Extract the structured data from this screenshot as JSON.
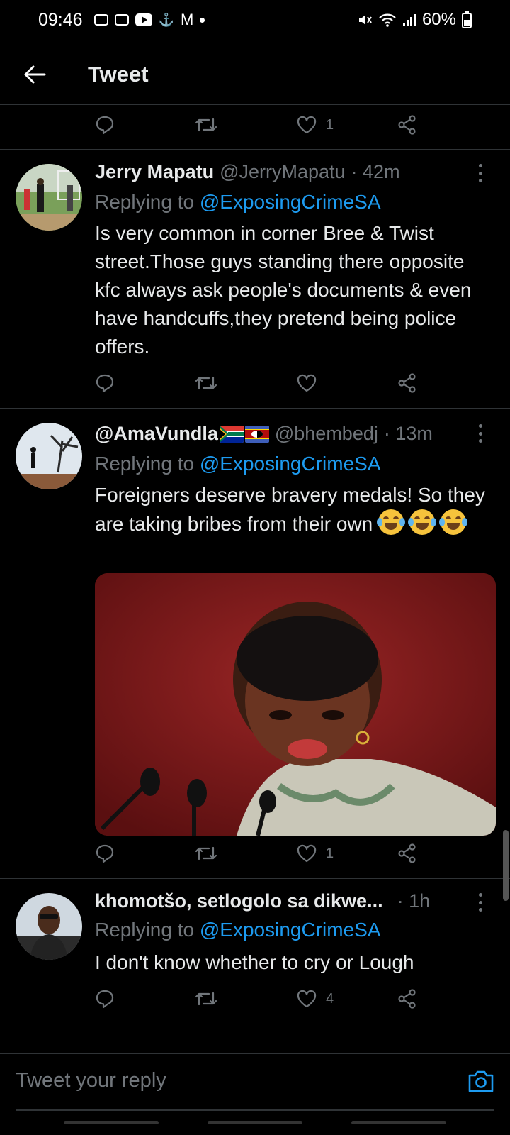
{
  "status_bar": {
    "time": "09:46",
    "battery": "60%",
    "icons": [
      "youtube-studio-icon",
      "youtube-studio-icon",
      "youtube-icon",
      "notification-icon",
      "gmail-icon",
      "dot-icon",
      "mute-icon",
      "wifi-icon",
      "signal-icon",
      "battery-icon"
    ]
  },
  "header": {
    "title": "Tweet"
  },
  "top_actions": {
    "like_count": "1"
  },
  "tweets": [
    {
      "name": "Jerry Mapatu",
      "handle": "@JerryMapatu",
      "time": "· 42m",
      "replying_prefix": "Replying to ",
      "replying_to": "@ExposingCrimeSA",
      "text": "Is very common in corner Bree & Twist street.Those guys standing there opposite kfc always ask people's documents & even have handcuffs,they pretend being police offers.",
      "like_count": ""
    },
    {
      "name": "@AmaVundla",
      "handle": "@bhembedj",
      "time": "· 13m",
      "replying_prefix": "Replying to ",
      "replying_to": "@ExposingCrimeSA",
      "text": "Foreigners deserve bravery medals! So they are taking bribes from their own",
      "like_count": "1"
    },
    {
      "name": "khomotšo, setlogolo sa dikwe...",
      "handle": "",
      "time": "· 1h",
      "replying_prefix": "Replying to ",
      "replying_to": "@ExposingCrimeSA",
      "text": "I don't know whether to cry or Lough",
      "like_count": "4"
    }
  ],
  "composer": {
    "placeholder": "Tweet your reply"
  },
  "colors": {
    "background": "#000000",
    "text": "#e7e9ea",
    "secondary": "#71767b",
    "accent": "#1d9bf0",
    "divider": "#2f3336"
  }
}
